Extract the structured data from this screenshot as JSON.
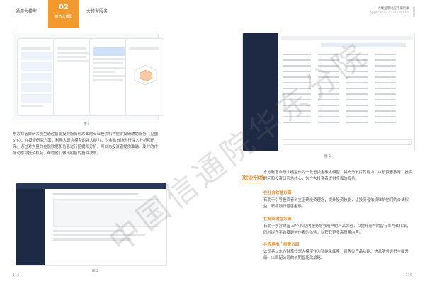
{
  "nav": {
    "item1": "通用大模型",
    "active_num": "02",
    "active_label": "垂直大模型",
    "item3": "大模型服务"
  },
  "header_right": {
    "line1": "大模型落地应用案例集",
    "line2": "Application Cases of LLM"
  },
  "figures": {
    "fig1": "图 4",
    "fig2": "图 5",
    "fig3": "图 6"
  },
  "left_para": "东方财富自研大模型通过智能投顾服务形态面向专业投资机构提供投研辅助服务（见图 5-6），在投资研究方面，利用大语言模型的强大能力，对金融市场进行深入分析和研究。通过对大量的金融数据和信息进行挖掘和分析，可以为投资者提供准确、及时的市场动态和投资机会，帮助他们做出明智的投资决策。",
  "right": {
    "section_title": "就业分析",
    "intro": "东方财富自研大模型作为一款垂类金融大模型，将充分发挥其能力，以投资者教育、投资顾问和投资研究为核心，为广大投资者提供全面的服务。",
    "h1": "在社会效益方面",
    "p1": "有助于引导投资者树立正确投资理念，提升投资技能，让投资者依规维护他们的合法权益，积极践行普惠金融。",
    "h2": "在商业效益方面",
    "p2": "有助于东方财富 APP 和站内服务增强用户的产品体验，以提升用户的留存率与转化率，同时提升平台投顾创作者的体验，以获取更多高质量内容。",
    "h3": "在应用推广前景方面",
    "p3": "公司将以东方财富妙想大模型作为智能化底座，对各类产品功能、信息服务进行全面升级，以匹配公司的长期智能化战略。"
  },
  "watermark": "中国信通院华东分院",
  "page_numbers": {
    "left": "115",
    "right": "116"
  }
}
